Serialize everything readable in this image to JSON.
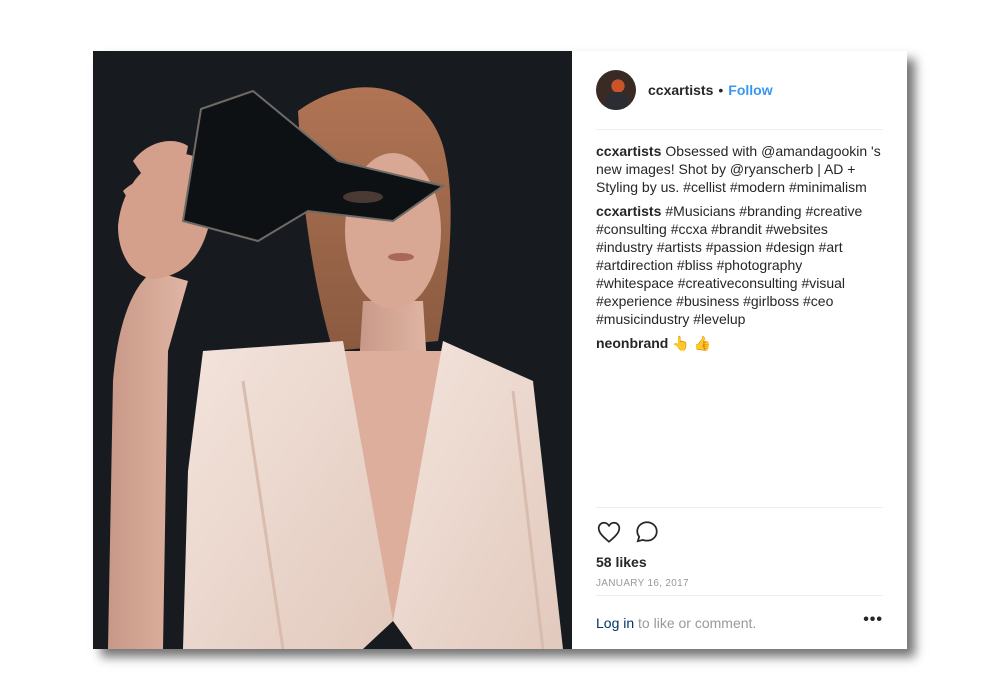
{
  "post": {
    "username": "ccxartists",
    "follow_label": "Follow",
    "separator": "•",
    "comments": [
      {
        "user": "ccxartists",
        "text": "Obsessed with @amandagookin 's new images! Shot by @ryanscherb | AD + Styling by us. #cellist #modern #minimalism"
      },
      {
        "user": "ccxartists",
        "text": "#Musicians #branding #creative #consulting #ccxa #brandit #websites #industry #artists #passion #design #art #artdirection #bliss #photography #whitespace #creativeconsulting #visual #experience #business #girlboss #ceo #musicindustry #levelup"
      },
      {
        "user": "neonbrand",
        "text": "👆 👍"
      }
    ],
    "likes": "58 likes",
    "date": "JANUARY 16, 2017",
    "login_link": "Log in",
    "login_rest": " to like or comment.",
    "more_label": "•••"
  },
  "icons": {
    "like": "heart-icon",
    "comment": "comment-icon",
    "more": "ellipsis-icon"
  },
  "colors": {
    "accent": "#3897f0",
    "text": "#262626",
    "muted": "#999999",
    "link_dark": "#003569",
    "photo_bg": "#171b1f"
  }
}
